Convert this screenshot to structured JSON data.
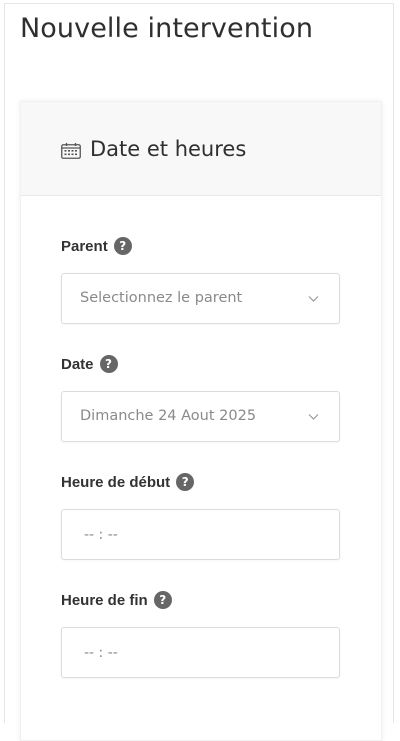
{
  "page": {
    "title": "Nouvelle intervention"
  },
  "section": {
    "title": "Date et heures",
    "icon": "calendar-icon"
  },
  "fields": {
    "parent": {
      "label": "Parent",
      "help": "?",
      "value": "Selectionnez le parent"
    },
    "date": {
      "label": "Date",
      "help": "?",
      "value": "Dimanche 24 Aout 2025"
    },
    "start_time": {
      "label": "Heure de début",
      "help": "?",
      "placeholder": "-- : --"
    },
    "end_time": {
      "label": "Heure de fin",
      "help": "?",
      "placeholder": "-- : --"
    }
  },
  "colors": {
    "text": "#2f2f2f",
    "muted": "#8a8a8a",
    "help_badge": "#666666",
    "border": "#dcdcdc",
    "header_bg": "#f8f8f8"
  }
}
